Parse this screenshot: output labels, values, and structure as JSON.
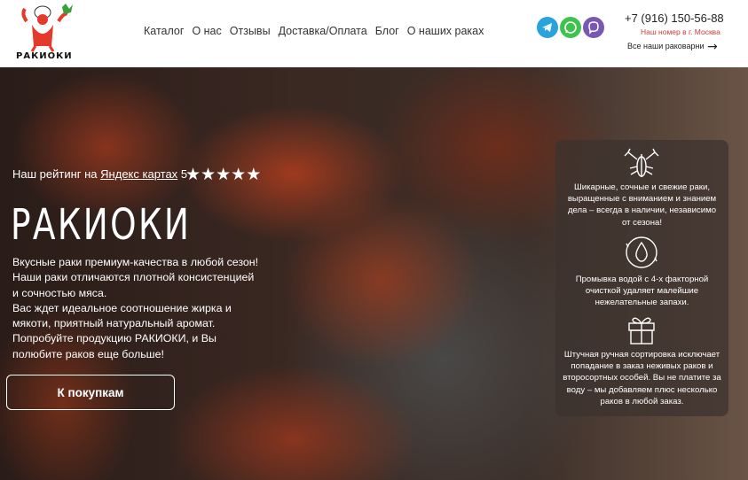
{
  "logo": {
    "text": "РАКИОКИ"
  },
  "nav": [
    {
      "label": "Каталог"
    },
    {
      "label": "О нас"
    },
    {
      "label": "Отзывы"
    },
    {
      "label": "Доставка/Оплата"
    },
    {
      "label": "Блог"
    },
    {
      "label": "О наших раках"
    }
  ],
  "social": [
    {
      "icon": "telegram-icon",
      "color": "#2aa3dd"
    },
    {
      "icon": "whatsapp-icon",
      "color": "#3ec34f"
    },
    {
      "icon": "viber-icon",
      "color": "#7b57b4"
    }
  ],
  "contact": {
    "phone": "+7 (916) 150-56-88",
    "note": "Наш номер в г. Москва",
    "shops_link": "Все наши раковарни"
  },
  "hero": {
    "rating_prefix": "Наш рейтинг на",
    "rating_link": "Яндекс картах",
    "rating_value": "5",
    "stars": 5,
    "title": "РАКИОКИ",
    "description_lines": [
      "Вкусные раки премиум-качества в любой сезон!",
      "Наши раки отличаются плотной консистенцией",
      "и сочностью мяса.",
      "Вас ждет идеальное соотношение жирка и",
      "мякоти, приятный натуральный аромат.",
      "Попробуйте продукцию РАКИОКИ, и Вы",
      "полюбите раков еще больше!"
    ],
    "cta_label": "К покупкам"
  },
  "features": [
    {
      "icon": "crayfish-icon",
      "lines": [
        "Шикарные, сочные и свежие раки,",
        "выращенные с вниманием и знанием",
        "дела – всегда в наличии, независимо",
        "от сезона!"
      ]
    },
    {
      "icon": "water-drop-icon",
      "lines": [
        "Промывка водой с 4-х факторной",
        "очисткой удаляет малейшие",
        "нежелательные запахи."
      ]
    },
    {
      "icon": "gift-icon",
      "lines": [
        "Штучная ручная сортировка исключает",
        "попадание в заказ неживых раков и",
        "второсортных особей. Вы не платите за",
        "воду – мы добавляем плюс несколько",
        "раков в любой заказ."
      ]
    }
  ]
}
